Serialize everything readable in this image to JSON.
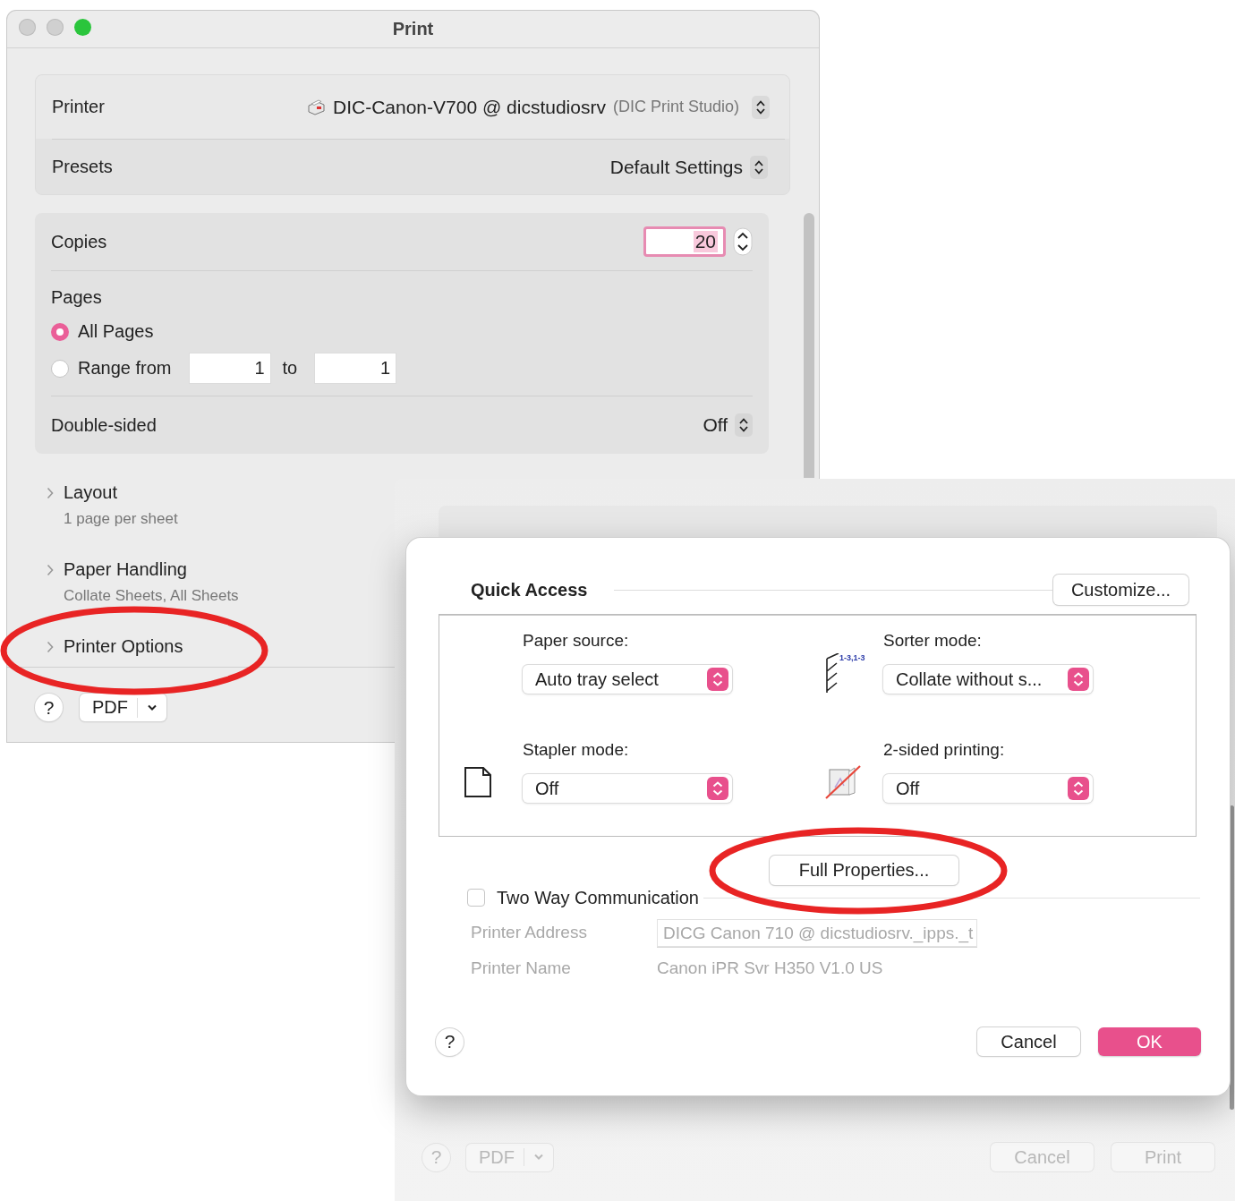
{
  "print_window": {
    "title": "Print",
    "printer": {
      "label": "Printer",
      "name": "DIC-Canon-V700 @ dicstudiosrv",
      "detail": "(DIC Print Studio)"
    },
    "presets": {
      "label": "Presets",
      "value": "Default Settings"
    },
    "copies": {
      "label": "Copies",
      "value": "20"
    },
    "pages": {
      "label": "Pages",
      "options": [
        {
          "label": "All Pages",
          "selected": true
        },
        {
          "label": "Range from",
          "selected": false
        }
      ],
      "range_from": "1",
      "range_to_label": "to",
      "range_to": "1"
    },
    "double_sided": {
      "label": "Double-sided",
      "value": "Off"
    },
    "sections": [
      {
        "title": "Layout",
        "summary": "1 page per sheet"
      },
      {
        "title": "Paper Handling",
        "summary": "Collate Sheets, All Sheets"
      },
      {
        "title": "Printer Options"
      }
    ],
    "help": "?",
    "pdf": "PDF"
  },
  "background_window": {
    "help": "?",
    "pdf": "PDF",
    "buttons": [
      "Cancel",
      "Print"
    ]
  },
  "quick_access": {
    "title": "Quick Access",
    "customize": "Customize...",
    "settings": [
      {
        "label": "Paper source:",
        "value": "Auto tray select",
        "kind": "plain"
      },
      {
        "label": "Sorter mode:",
        "value": "Collate without s...",
        "kind": "sorter",
        "icon_caption": "1-3,1-3"
      },
      {
        "label": "Stapler mode:",
        "value": "Off",
        "kind": "stapler"
      },
      {
        "label": "2-sided printing:",
        "value": "Off",
        "kind": "duplex"
      }
    ],
    "full_properties": "Full Properties...",
    "two_way": {
      "label": "Two Way Communication",
      "checked": false
    },
    "info": [
      {
        "label": "Printer Address",
        "value": "DICG Canon 710 @ dicstudiosrv._ipps._t",
        "kind": "field",
        "disabled": true
      },
      {
        "label": "Printer Name",
        "value": "Canon iPR Svr H350 V1.0 US",
        "kind": "text",
        "disabled": true
      }
    ],
    "help": "?",
    "buttons": [
      {
        "label": "Cancel",
        "default": false
      },
      {
        "label": "OK",
        "default": true
      }
    ]
  },
  "annotations": [
    {
      "kind": "ellipse"
    },
    {
      "kind": "ellipse"
    }
  ]
}
